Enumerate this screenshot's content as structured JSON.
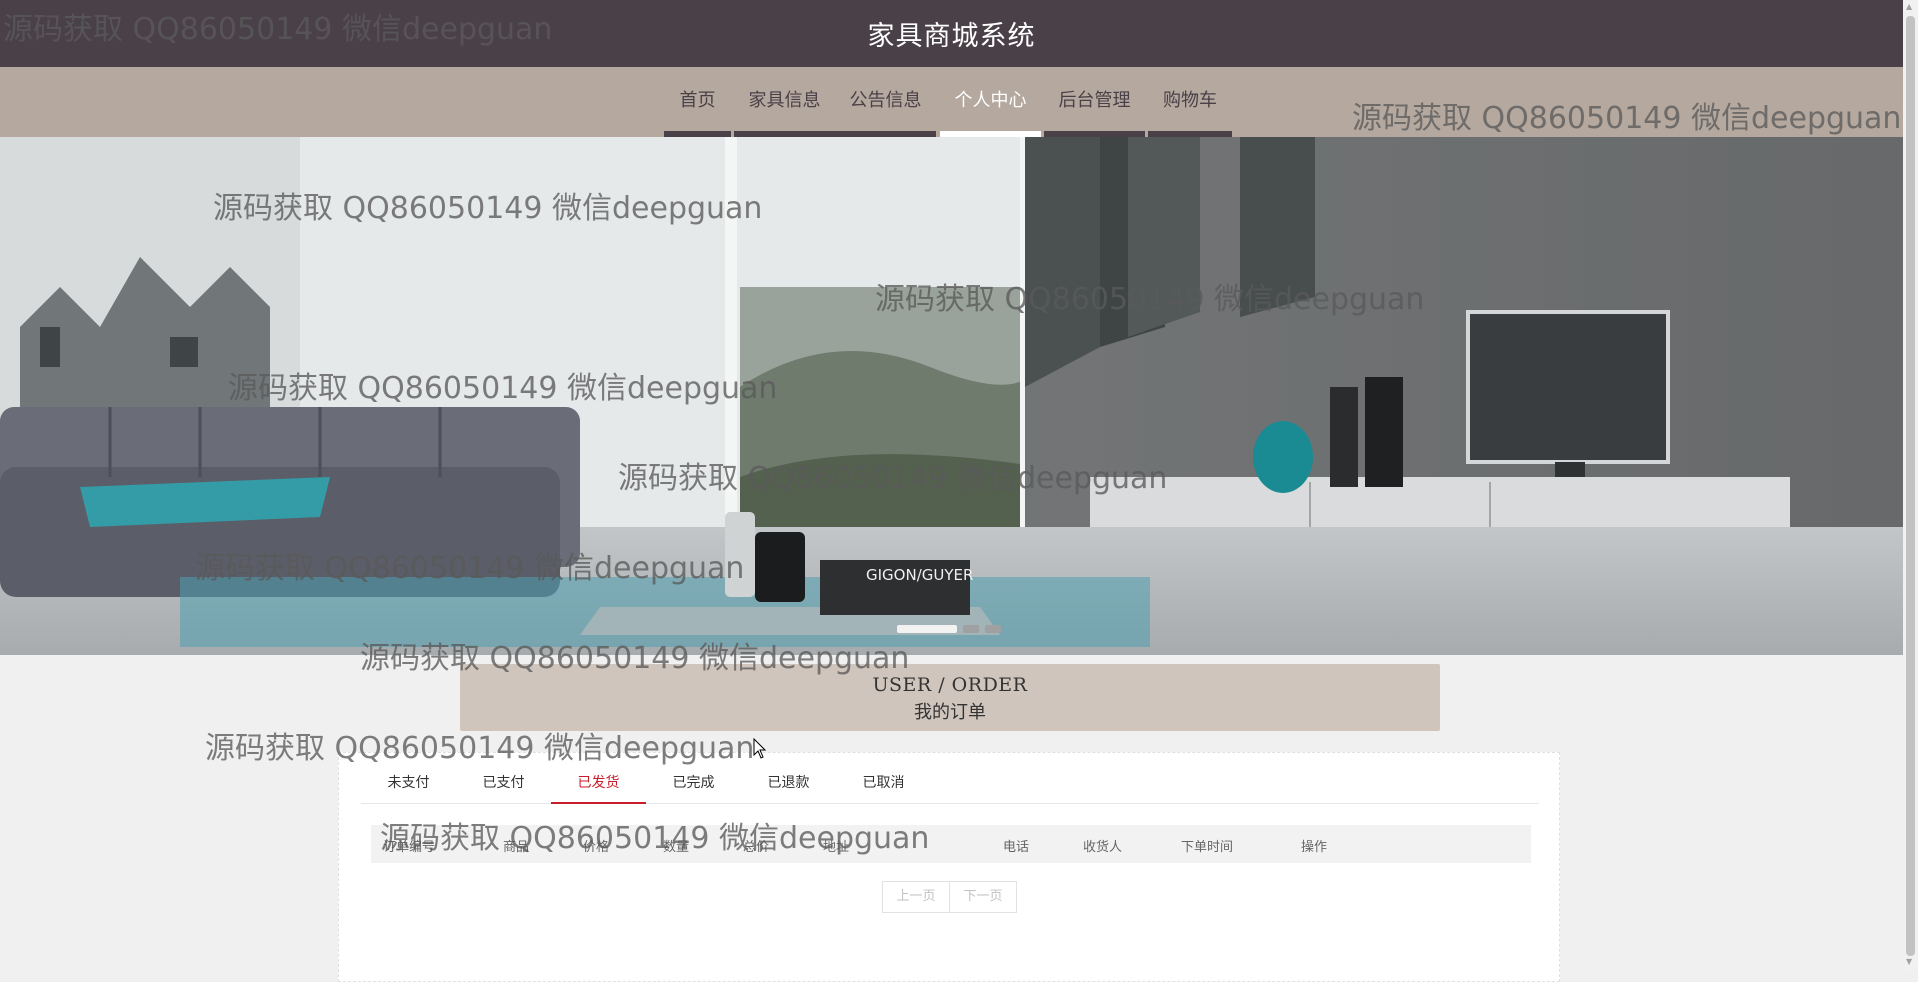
{
  "header": {
    "title": "家具商城系统"
  },
  "nav": [
    {
      "label": "首页"
    },
    {
      "label": "家具信息"
    },
    {
      "label": "公告信息"
    },
    {
      "label": "个人中心",
      "active": true
    },
    {
      "label": "后台管理"
    },
    {
      "label": "购物车"
    }
  ],
  "banner": {
    "book_text": "GIGON/GUYER",
    "active_slide": 1,
    "slide_count": 3
  },
  "section": {
    "title_en": "USER / ORDER",
    "title_zh": "我的订单"
  },
  "tabs": [
    "未支付",
    "已支付",
    "已发货",
    "已完成",
    "已退款",
    "已取消"
  ],
  "active_tab": "已发货",
  "table": {
    "columns": [
      "订单编号",
      "商品",
      "价格",
      "数量",
      "总价",
      "地址",
      "电话",
      "收货人",
      "下单时间",
      "操作"
    ],
    "rows": []
  },
  "pager": {
    "prev": "上一页",
    "next": "下一页"
  },
  "watermark": "源码获取 QQ86050149 微信deepguan",
  "colors": {
    "header_bg": "#4a4048",
    "nav_bg": "#b5a89f",
    "section_bg": "#d0c5bc",
    "active_tab": "#c81d2a"
  }
}
